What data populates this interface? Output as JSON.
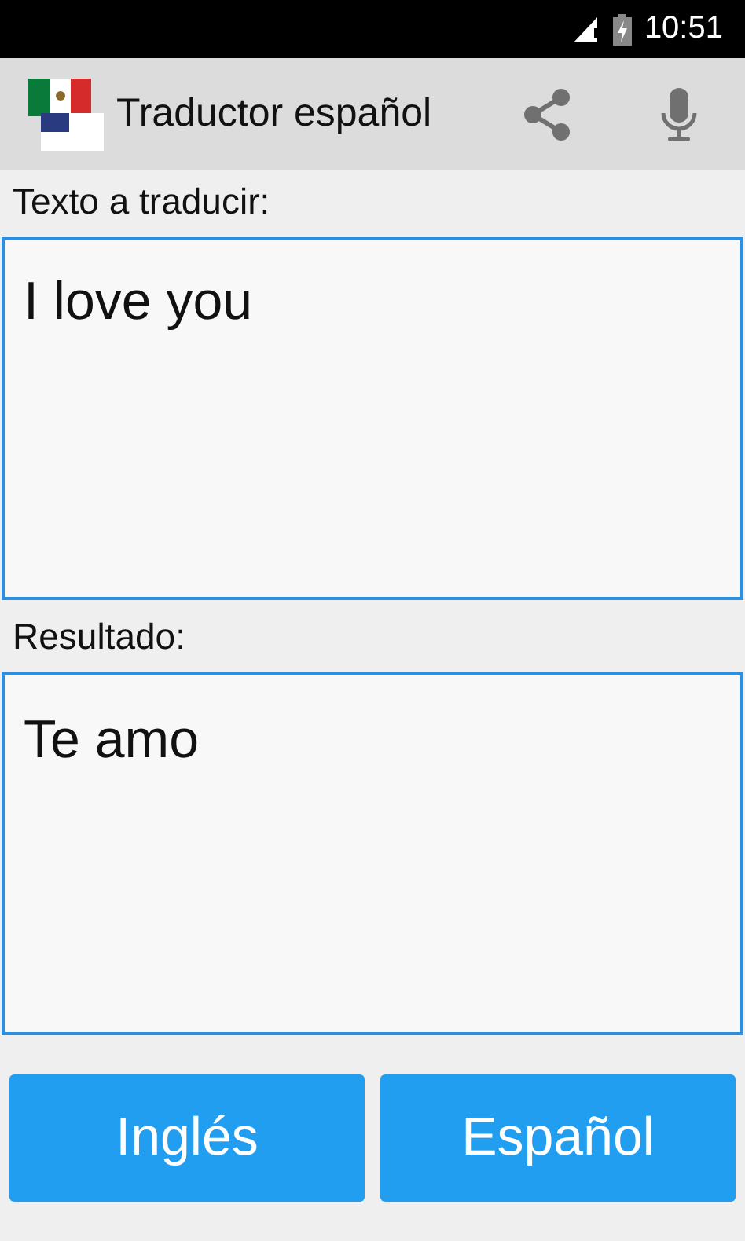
{
  "status_bar": {
    "time": "10:51"
  },
  "app_bar": {
    "title": "Traductor español"
  },
  "input": {
    "label": "Texto a traducir:",
    "value": "I love you"
  },
  "result": {
    "label": "Resultado:",
    "text": "Te amo"
  },
  "buttons": [
    {
      "label": "Inglés"
    },
    {
      "label": "Español"
    }
  ]
}
